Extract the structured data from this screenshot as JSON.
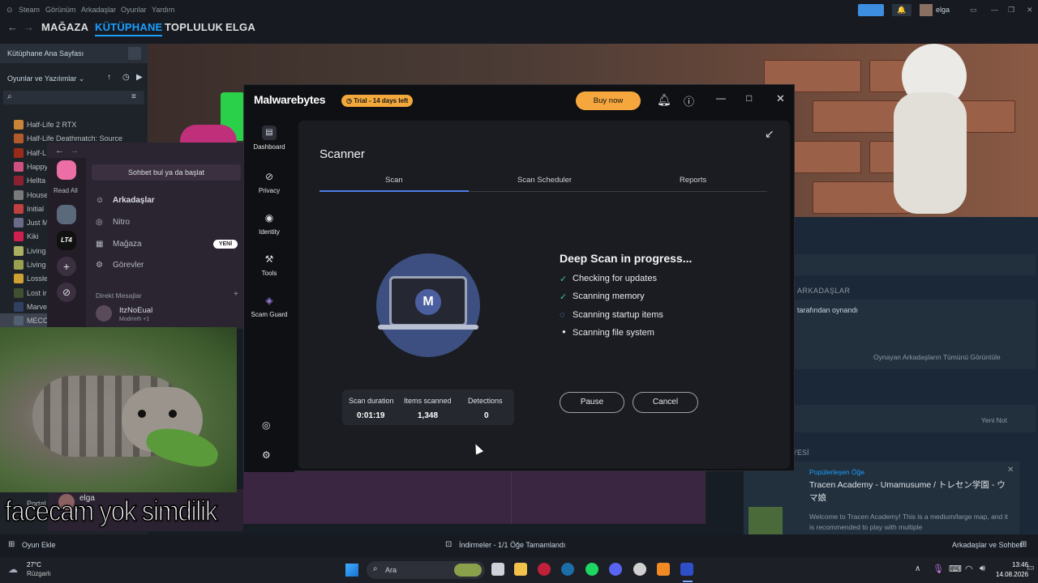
{
  "steam": {
    "menu": [
      "Steam",
      "Görünüm",
      "Arkadaşlar",
      "Oyunlar",
      "Yardım"
    ],
    "user": "elga",
    "nav": {
      "store": "MAĞAZA",
      "library": "KÜTÜPHANE",
      "community": "TOPLULUK",
      "profile": "ELGA"
    },
    "sidebar": {
      "home": "Kütüphane Ana Sayfası",
      "filter": "Oyunlar ve Yazılımlar",
      "games": [
        {
          "label": "Half-Life 2 RTX",
          "color": "#c9843a"
        },
        {
          "label": "Half-Life Deathmatch: Source",
          "color": "#b35a2a"
        },
        {
          "label": "Half-L",
          "color": "#9a2a1a"
        },
        {
          "label": "Happy",
          "color": "#d05080"
        },
        {
          "label": "Hellta",
          "color": "#8a2030"
        },
        {
          "label": "House",
          "color": "#7a7a7a"
        },
        {
          "label": "Initial",
          "color": "#c04040"
        },
        {
          "label": "Just M",
          "color": "#6a6a8a"
        },
        {
          "label": "Kiki",
          "color": "#d02050"
        },
        {
          "label": "Living",
          "color": "#aab060"
        },
        {
          "label": "Living",
          "color": "#9aa050"
        },
        {
          "label": "Lossle",
          "color": "#d0a030"
        },
        {
          "label": "Lost ir",
          "color": "#405030"
        },
        {
          "label": "Marve",
          "color": "#304060"
        },
        {
          "label": "MECC",
          "color": "#506070"
        }
      ],
      "extra": "Portal"
    },
    "right": {
      "friends_header": "ARKADAŞLAR",
      "played_by": "tarafından oynandı",
      "view_all": "Oynayan Arkadaşların Tümünü Görüntüle",
      "new_note": "Yeni Not",
      "workshop_header": "YESİ",
      "popular": "Popülerleşen Öğe",
      "item_title": "Tracen Academy - Umamusume / トレセン学園 - ウマ娘",
      "item_desc": "Welcome to Tracen Academy! This is a medium/large map, and it is recommended to play with multiple"
    },
    "bottom": {
      "add_game": "Oyun Ekle",
      "downloads": "İndirmeler - 1/1 Öğe Tamamlandı",
      "friends_chat": "Arkadaşlar ve Sohbet"
    }
  },
  "discord": {
    "read_all": "Read All",
    "search": "Sohbet bul ya da başlat",
    "nav": [
      {
        "label": "Arkadaşlar"
      },
      {
        "label": "Nitro"
      },
      {
        "label": "Mağaza",
        "badge": "YENİ"
      },
      {
        "label": "Görevler"
      }
    ],
    "dm_header": "Direkt Mesajlar",
    "dm_user": "ItzNoEual",
    "dm_status": "Modrinth +1",
    "server_tag": "LT4",
    "bottom_user": "elga"
  },
  "caption": "facecam yok simdilik",
  "malwarebytes": {
    "logo": "Malwarebytes",
    "trial": "Trial - 14 days left",
    "buy": "Buy now",
    "sidebar": [
      "Dashboard",
      "Privacy",
      "Identity",
      "Tools",
      "Scam Guard"
    ],
    "title": "Scanner",
    "tabs": [
      "Scan",
      "Scan Scheduler",
      "Reports"
    ],
    "status_title": "Deep Scan in progress...",
    "steps": [
      {
        "label": "Checking for updates",
        "state": "done"
      },
      {
        "label": "Scanning memory",
        "state": "done"
      },
      {
        "label": "Scanning startup items",
        "state": "active"
      },
      {
        "label": "Scanning file system",
        "state": "pending"
      }
    ],
    "stats": [
      {
        "label": "Scan duration",
        "value": "0:01:19"
      },
      {
        "label": "Items scanned",
        "value": "1,348"
      },
      {
        "label": "Detections",
        "value": "0"
      }
    ],
    "pause": "Pause",
    "cancel": "Cancel"
  },
  "taskbar": {
    "temp": "27°C",
    "weather": "Rüzgarlı",
    "search": "Ara",
    "time": "13:46",
    "date": "14.08.2026"
  }
}
